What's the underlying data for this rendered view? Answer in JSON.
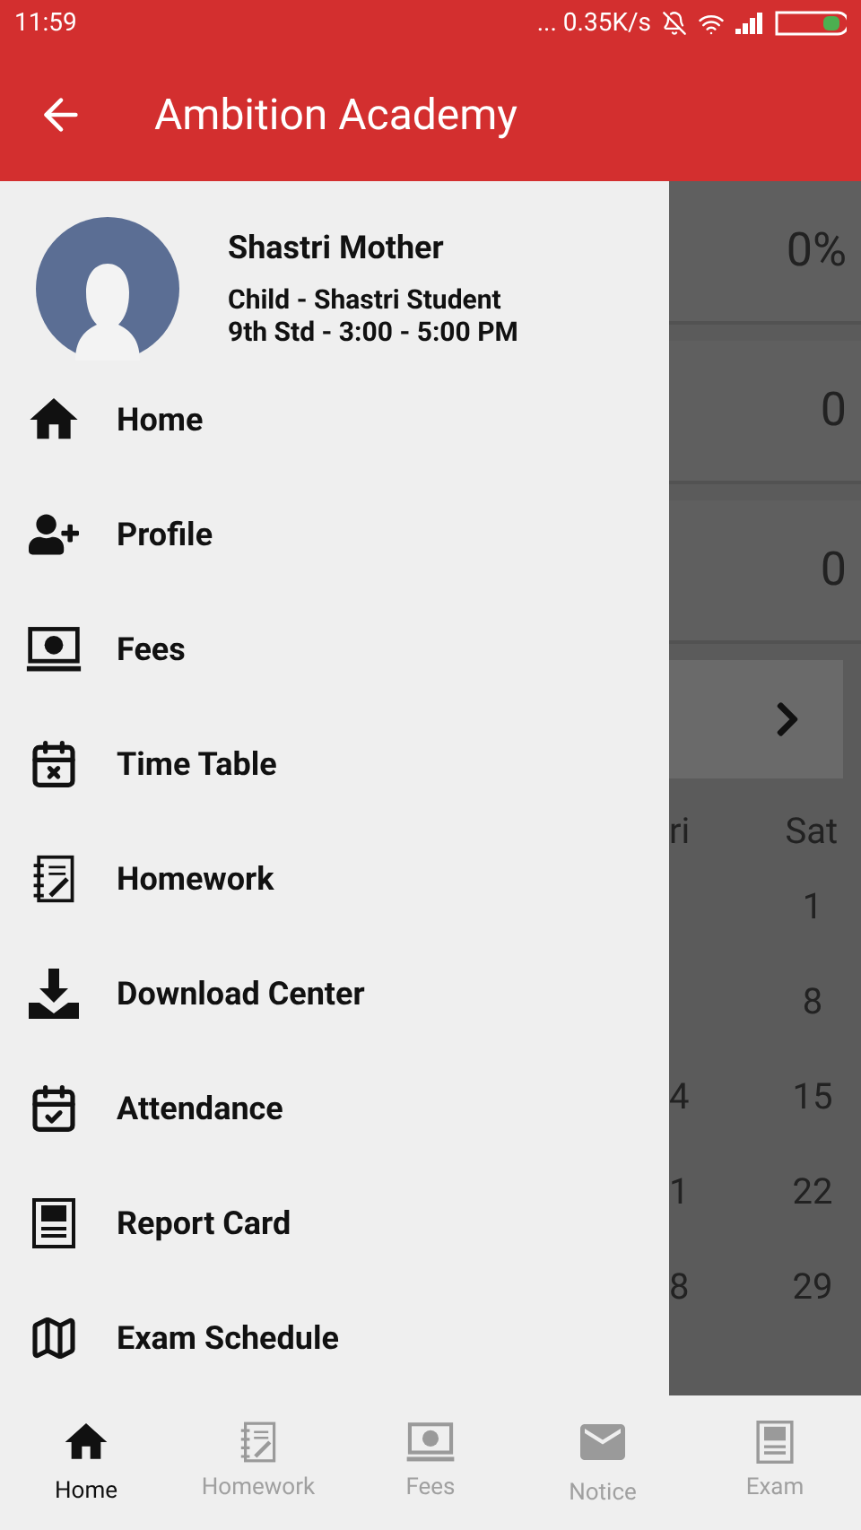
{
  "status_bar": {
    "time": "11:59",
    "network_speed": "... 0.35K/s"
  },
  "app_bar": {
    "title": "Ambition Academy"
  },
  "drawer": {
    "profile": {
      "name": "Shastri Mother",
      "child": "Child - Shastri Student",
      "batch": "9th Std - 3:00 - 5:00 PM"
    },
    "items": [
      {
        "label": "Home",
        "kind": "home"
      },
      {
        "label": "Profile",
        "kind": "profile"
      },
      {
        "label": "Fees",
        "kind": "fees"
      },
      {
        "label": "Time Table",
        "kind": "timetable"
      },
      {
        "label": "Homework",
        "kind": "homework"
      },
      {
        "label": "Download Center",
        "kind": "download"
      },
      {
        "label": "Attendance",
        "kind": "attendance"
      },
      {
        "label": "Report Card",
        "kind": "report"
      },
      {
        "label": "Exam Schedule",
        "kind": "schedule"
      }
    ]
  },
  "background": {
    "stats": [
      "0%",
      "0",
      "0"
    ],
    "calendar": {
      "day_headers": [
        "ri",
        "Sat"
      ],
      "weeks": [
        [
          "1"
        ],
        [
          "8"
        ],
        [
          "4",
          "15"
        ],
        [
          "1",
          "22"
        ],
        [
          "8",
          "29"
        ]
      ]
    }
  },
  "bottom_nav": [
    {
      "label": "Home",
      "kind": "home",
      "selected": true
    },
    {
      "label": "Homework",
      "kind": "homework",
      "selected": false
    },
    {
      "label": "Fees",
      "kind": "fees",
      "selected": false
    },
    {
      "label": "Notice",
      "kind": "notice",
      "selected": false
    },
    {
      "label": "Exam",
      "kind": "report",
      "selected": false
    }
  ]
}
